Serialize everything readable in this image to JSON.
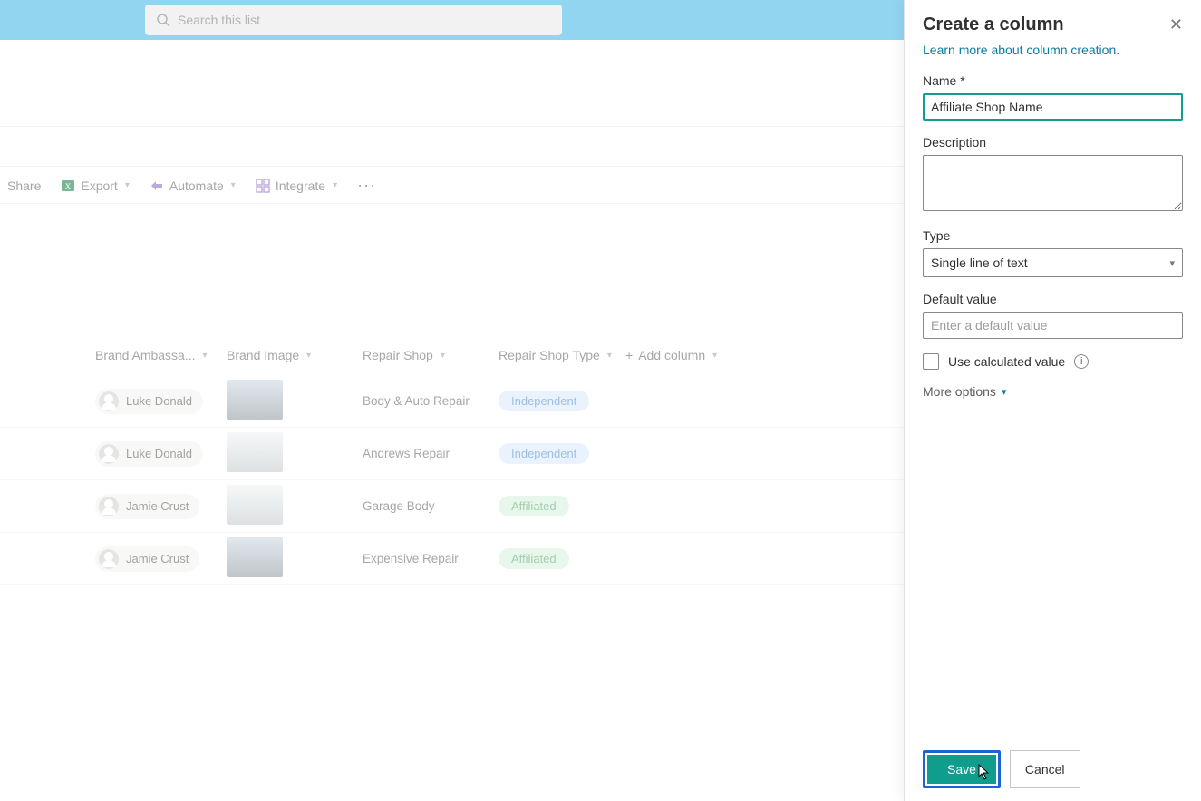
{
  "top": {
    "search_placeholder": "Search this list"
  },
  "commands": {
    "share": "Share",
    "export": "Export",
    "automate": "Automate",
    "integrate": "Integrate"
  },
  "columns": {
    "ambassador": "Brand Ambassa...",
    "brand_image": "Brand Image",
    "repair_shop": "Repair Shop",
    "repair_shop_type": "Repair Shop Type",
    "add_column": "Add column"
  },
  "rows": [
    {
      "person": "Luke Donald",
      "shop": "Body & Auto Repair",
      "type": "Independent",
      "type_class": "indep",
      "thumb": ""
    },
    {
      "person": "Luke Donald",
      "shop": "Andrews Repair",
      "type": "Independent",
      "type_class": "indep",
      "thumb": "light"
    },
    {
      "person": "Jamie Crust",
      "shop": "Garage Body",
      "type": "Affiliated",
      "type_class": "affil",
      "thumb": "light"
    },
    {
      "person": "Jamie Crust",
      "shop": "Expensive Repair",
      "type": "Affiliated",
      "type_class": "affil",
      "thumb": ""
    }
  ],
  "panel": {
    "title": "Create a column",
    "learn_more": "Learn more about column creation.",
    "name_label": "Name *",
    "name_value": "Affiliate Shop Name",
    "desc_label": "Description",
    "desc_value": "",
    "type_label": "Type",
    "type_value": "Single line of text",
    "default_label": "Default value",
    "default_placeholder": "Enter a default value",
    "use_calc": "Use calculated value",
    "more_options": "More options",
    "save": "Save",
    "cancel": "Cancel"
  }
}
